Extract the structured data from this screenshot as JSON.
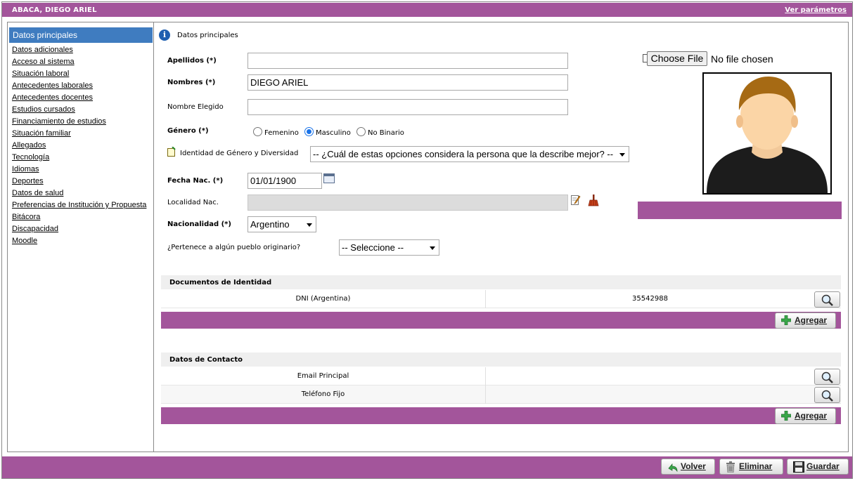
{
  "header": {
    "title": "ABACA, DIEGO ARIEL",
    "params_link": "Ver parámetros"
  },
  "sidebar": {
    "active": "Datos principales",
    "items": [
      "Datos adicionales",
      "Acceso al sistema",
      "Situación laboral",
      "Antecedentes laborales",
      "Antecedentes docentes",
      "Estudios cursados",
      "Financiamiento de estudios",
      "Situación familiar",
      "Allegados",
      "Tecnología",
      "Idiomas",
      "Deportes",
      "Datos de salud",
      "Preferencias de Institución y Propuesta",
      "Bitácora",
      "Discapacidad",
      "Moodle"
    ]
  },
  "form": {
    "section_title": "Datos principales",
    "apellidos_label": "Apellidos (*)",
    "apellidos_value": "",
    "nombres_label": "Nombres (*)",
    "nombres_value": "DIEGO ARIEL",
    "nombre_elegido_label": "Nombre Elegido",
    "nombre_elegido_value": "",
    "genero_label": "Género (*)",
    "genero_options": [
      "Femenino",
      "Masculino",
      "No Binario"
    ],
    "genero_selected": "Masculino",
    "identidad_label": "Identidad de Género y Diversidad",
    "identidad_value": "-- ¿Cuál de estas opciones considera la persona que la describe mejor? --",
    "fecha_label": "Fecha Nac. (*)",
    "fecha_value": "01/01/1900",
    "localidad_label": "Localidad Nac.",
    "localidad_value": "",
    "nacionalidad_label": "Nacionalidad (*)",
    "nacionalidad_value": "Argentino",
    "pueblo_label": "¿Pertenece a algún pueblo originario?",
    "pueblo_value": "-- Seleccione --"
  },
  "photo": {
    "choose_file_label": "Choose File",
    "no_file_text": "No file chosen"
  },
  "documentos": {
    "title": "Documentos de Identidad",
    "rows": [
      {
        "tipo": "DNI (Argentina)",
        "numero": "35542988"
      }
    ],
    "add_label": "Agregar"
  },
  "contacto": {
    "title": "Datos de Contacto",
    "rows": [
      {
        "tipo": "Email Principal",
        "valor": ""
      },
      {
        "tipo": "Teléfono Fijo",
        "valor": ""
      }
    ],
    "add_label": "Agregar"
  },
  "footer": {
    "volver_label": "Volver",
    "eliminar_label": "Eliminar",
    "guardar_label": "Guardar"
  },
  "colors": {
    "accent": "#a3559b",
    "sidebar_active": "#3f7cc0"
  }
}
